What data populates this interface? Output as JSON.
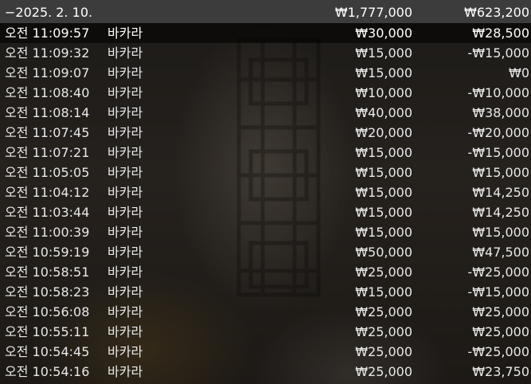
{
  "summary": {
    "date": "−2025. 2. 10.",
    "total_bet": "₩1,777,000",
    "total_win": "₩623,200"
  },
  "rows": [
    {
      "time": "오전 11:09:57",
      "game": "바카라",
      "bet": "₩30,000",
      "result": "₩28,500"
    },
    {
      "time": "오전 11:09:32",
      "game": "바카라",
      "bet": "₩15,000",
      "result": "-₩15,000"
    },
    {
      "time": "오전 11:09:07",
      "game": "바카라",
      "bet": "₩15,000",
      "result": "₩0"
    },
    {
      "time": "오전 11:08:40",
      "game": "바카라",
      "bet": "₩10,000",
      "result": "-₩10,000"
    },
    {
      "time": "오전 11:08:14",
      "game": "바카라",
      "bet": "₩40,000",
      "result": "₩38,000"
    },
    {
      "time": "오전 11:07:45",
      "game": "바카라",
      "bet": "₩20,000",
      "result": "-₩20,000"
    },
    {
      "time": "오전 11:07:21",
      "game": "바카라",
      "bet": "₩15,000",
      "result": "-₩15,000"
    },
    {
      "time": "오전 11:05:05",
      "game": "바카라",
      "bet": "₩15,000",
      "result": "₩15,000"
    },
    {
      "time": "오전 11:04:12",
      "game": "바카라",
      "bet": "₩15,000",
      "result": "₩14,250"
    },
    {
      "time": "오전 11:03:44",
      "game": "바카라",
      "bet": "₩15,000",
      "result": "₩14,250"
    },
    {
      "time": "오전 11:00:39",
      "game": "바카라",
      "bet": "₩15,000",
      "result": "₩15,000"
    },
    {
      "time": "오전 10:59:19",
      "game": "바카라",
      "bet": "₩50,000",
      "result": "₩47,500"
    },
    {
      "time": "오전 10:58:51",
      "game": "바카라",
      "bet": "₩25,000",
      "result": "-₩25,000"
    },
    {
      "time": "오전 10:58:23",
      "game": "바카라",
      "bet": "₩15,000",
      "result": "-₩15,000"
    },
    {
      "time": "오전 10:56:08",
      "game": "바카라",
      "bet": "₩25,000",
      "result": "₩25,000"
    },
    {
      "time": "오전 10:55:11",
      "game": "바카라",
      "bet": "₩25,000",
      "result": "₩25,000"
    },
    {
      "time": "오전 10:54:45",
      "game": "바카라",
      "bet": "₩25,000",
      "result": "-₩25,000"
    },
    {
      "time": "오전 10:54:16",
      "game": "바카라",
      "bet": "₩25,000",
      "result": "₩23,750"
    }
  ]
}
